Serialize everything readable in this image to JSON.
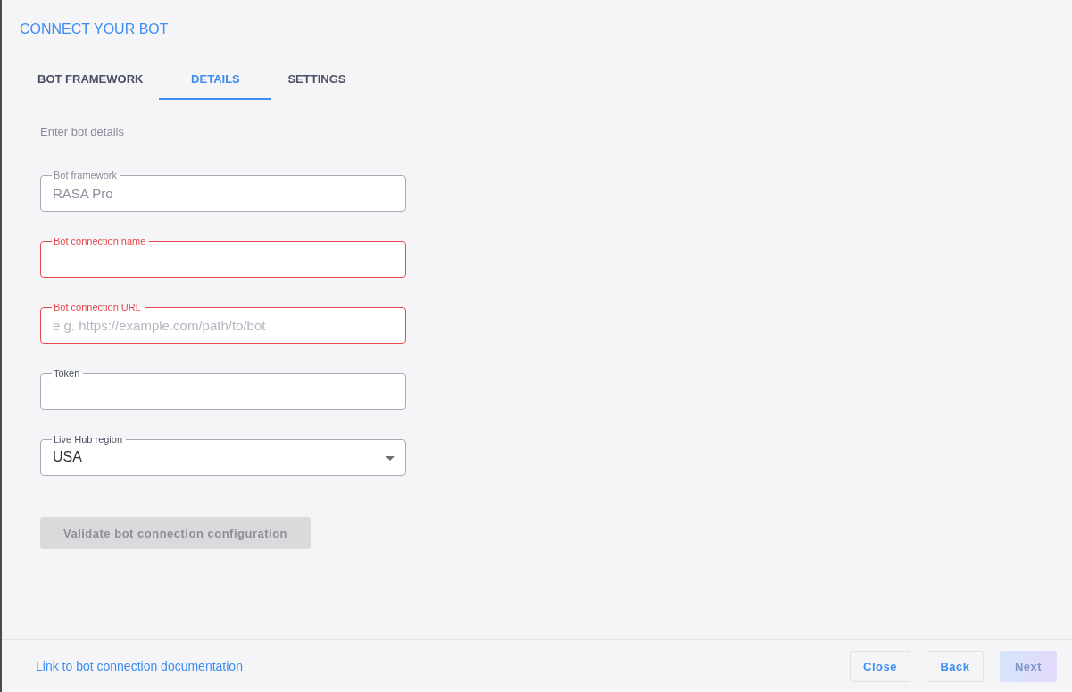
{
  "dialog": {
    "title": "CONNECT YOUR BOT"
  },
  "tabs": [
    {
      "label": "BOT FRAMEWORK",
      "selected": false
    },
    {
      "label": "DETAILS",
      "selected": true
    },
    {
      "label": "SETTINGS",
      "selected": false
    }
  ],
  "subtitle": "Enter bot details",
  "fields": [
    {
      "kind": "text",
      "label": "Bot framework",
      "value": "RASA Pro",
      "disabled": true,
      "error": false
    },
    {
      "kind": "text",
      "label": "Bot connection name",
      "disabled": false,
      "error": true
    },
    {
      "kind": "text",
      "label": "Bot connection URL",
      "placeholder": "e.g. https://example.com/path/to/bot",
      "disabled": false,
      "error": true
    },
    {
      "kind": "text",
      "label": "Token",
      "disabled": false,
      "error": false
    },
    {
      "kind": "select",
      "label": "Live Hub region",
      "value": "USA",
      "disabled": false,
      "error": false
    }
  ],
  "validate_button": {
    "label": "Validate bot connection configuration",
    "disabled": true
  },
  "footer": {
    "link": "Link to bot connection documentation",
    "buttons": [
      {
        "label": "Close",
        "kind": "secondary",
        "disabled": false
      },
      {
        "label": "Back",
        "kind": "secondary",
        "disabled": false
      },
      {
        "label": "Next",
        "kind": "primary",
        "disabled": true
      }
    ]
  }
}
